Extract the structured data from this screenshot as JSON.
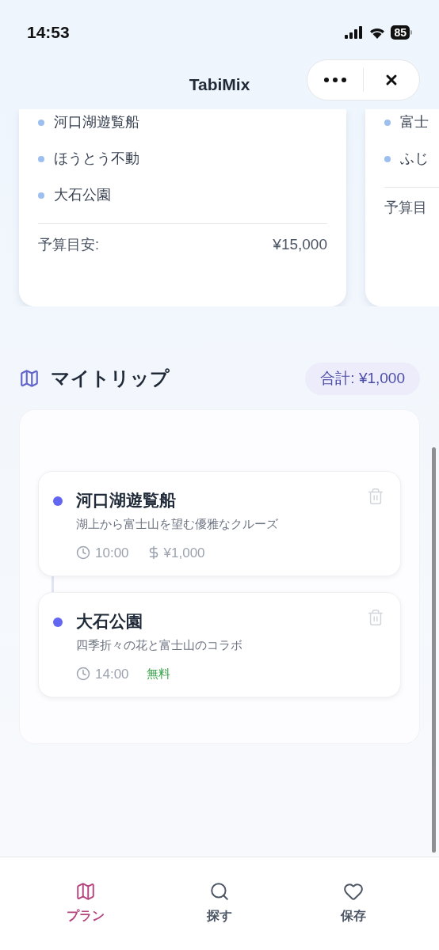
{
  "status_bar": {
    "time": "14:53",
    "battery": "85"
  },
  "header": {
    "title": "TabiMix"
  },
  "plan_cards": [
    {
      "items": [
        "河口湖遊覧船",
        "ほうとう不動",
        "大石公園"
      ],
      "budget_label": "予算目安:",
      "budget": "¥15,000"
    },
    {
      "items": [
        "富士",
        "ふじ"
      ],
      "budget_label": "予算目"
    }
  ],
  "my_trip": {
    "title": "マイトリップ",
    "total": "合計: ¥1,000",
    "stops": [
      {
        "name": "河口湖遊覧船",
        "description": "湖上から富士山を望む優雅なクルーズ",
        "time": "10:00",
        "price": "¥1,000",
        "kind": "paid"
      },
      {
        "name": "大石公園",
        "description": "四季折々の花と富士山のコラボ",
        "time": "14:00",
        "price": "無料",
        "kind": "free"
      }
    ]
  },
  "tab_bar": [
    {
      "label": "プラン",
      "kind": "plan",
      "selected": true
    },
    {
      "label": "探す",
      "kind": "explore",
      "selected": false
    },
    {
      "label": "保存",
      "kind": "saved",
      "selected": false
    }
  ]
}
